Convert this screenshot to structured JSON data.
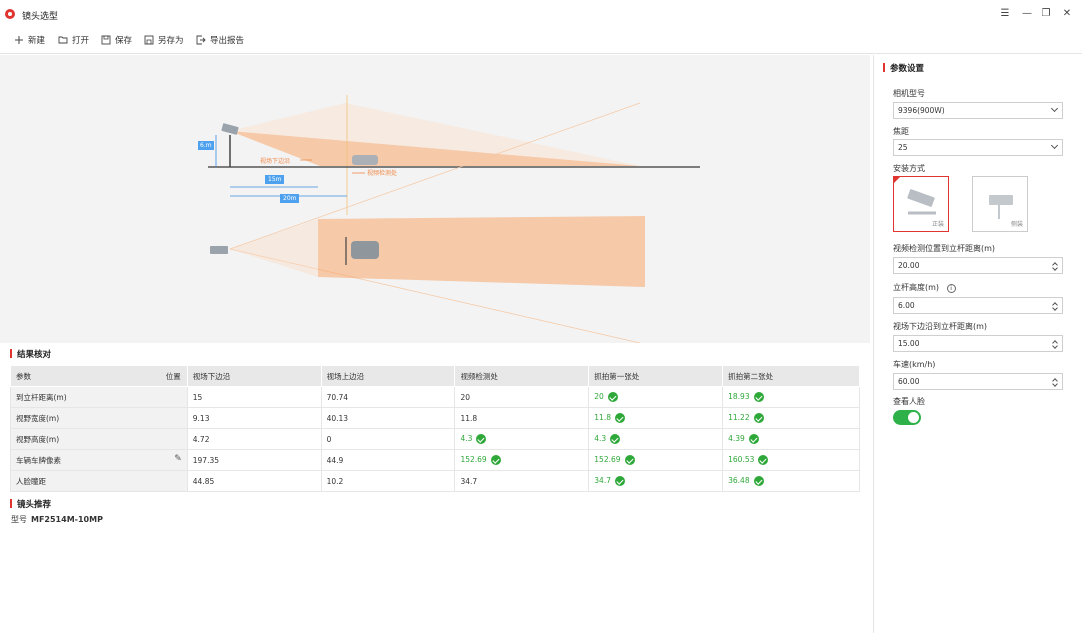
{
  "app": {
    "title": "镜头选型"
  },
  "toolbar": {
    "new": "新建",
    "open": "打开",
    "save": "保存",
    "save_as": "另存为",
    "export": "导出报告"
  },
  "diagram": {
    "height_label": "6.m",
    "dist1_label": "15m",
    "dist2_label": "20m",
    "lower_edge_label": "视场下边沿",
    "detect_label": "视频检测处"
  },
  "results": {
    "title": "结果核对",
    "header": {
      "param": "参数",
      "position": "位置",
      "cols": [
        "视场下边沿",
        "视场上边沿",
        "视频检测处",
        "抓拍第一张处",
        "抓拍第二张处"
      ]
    },
    "rows": [
      {
        "label": "到立杆距离(m)",
        "cells": [
          {
            "v": "15",
            "ok": false
          },
          {
            "v": "70.74",
            "ok": false
          },
          {
            "v": "20",
            "ok": false
          },
          {
            "v": "20",
            "ok": true
          },
          {
            "v": "18.93",
            "ok": true
          }
        ]
      },
      {
        "label": "视野宽度(m)",
        "cells": [
          {
            "v": "9.13",
            "ok": false
          },
          {
            "v": "40.13",
            "ok": false
          },
          {
            "v": "11.8",
            "ok": false
          },
          {
            "v": "11.8",
            "ok": true
          },
          {
            "v": "11.22",
            "ok": true
          }
        ]
      },
      {
        "label": "视野高度(m)",
        "cells": [
          {
            "v": "4.72",
            "ok": false
          },
          {
            "v": "0",
            "ok": false
          },
          {
            "v": "4.3",
            "ok": true
          },
          {
            "v": "4.3",
            "ok": true
          },
          {
            "v": "4.39",
            "ok": true
          }
        ]
      },
      {
        "label": "车辆车牌像素",
        "cells": [
          {
            "v": "197.35",
            "ok": false
          },
          {
            "v": "44.9",
            "ok": false
          },
          {
            "v": "152.69",
            "ok": true
          },
          {
            "v": "152.69",
            "ok": true
          },
          {
            "v": "160.53",
            "ok": true
          }
        ]
      },
      {
        "label": "人脸瞳距",
        "cells": [
          {
            "v": "44.85",
            "ok": false
          },
          {
            "v": "10.2",
            "ok": false
          },
          {
            "v": "34.7",
            "ok": false
          },
          {
            "v": "34.7",
            "ok": true
          },
          {
            "v": "36.48",
            "ok": true
          }
        ]
      }
    ]
  },
  "lens": {
    "title": "镜头推荐",
    "model_label": "型号",
    "model_value": "MF2514M-10MP"
  },
  "panel": {
    "title": "参数设置",
    "camera_label": "相机型号",
    "camera_value": "9396(900W)",
    "focal_label": "焦距",
    "focal_value": "25",
    "mount_label": "安装方式",
    "mount_options": [
      "正装",
      "侧装"
    ],
    "detect_dist_label": "视频检测位置到立杆距离(m)",
    "detect_dist_value": "20.00",
    "pole_height_label": "立杆高度(m)",
    "pole_height_value": "6.00",
    "lower_edge_label": "视场下边沿到立杆距离(m)",
    "lower_edge_value": "15.00",
    "speed_label": "车速(km/h)",
    "speed_value": "60.00",
    "face_label": "查看人脸",
    "face_on": true
  },
  "colors": {
    "accent": "#e0352f",
    "ok": "#2fa83a",
    "toggle": "#2fb14a",
    "fov": "#f7a56a"
  }
}
